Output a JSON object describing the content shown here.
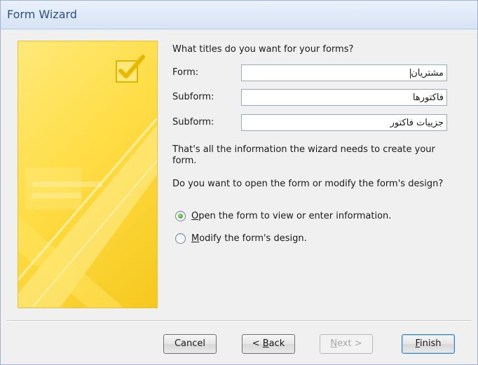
{
  "window": {
    "title": "Form Wizard"
  },
  "question": "What titles do you want for your forms?",
  "fields": [
    {
      "label": "Form:",
      "value": "مشتریان"
    },
    {
      "label": "Subform:",
      "value": "فاکتورها"
    },
    {
      "label": "Subform:",
      "value": "جزییات فاکتور"
    }
  ],
  "info_text": "That's all the information the wizard needs to create your form.",
  "prompt_text": "Do you want to open the form or modify the form's design?",
  "options": [
    {
      "mnemonic": "O",
      "rest": "pen the form to view or enter information.",
      "checked": true
    },
    {
      "mnemonic": "M",
      "rest": "odify the form's design.",
      "checked": false
    }
  ],
  "buttons": {
    "cancel": {
      "label": "Cancel"
    },
    "back": {
      "prefix": "< ",
      "mnemonic": "B",
      "rest": "ack"
    },
    "next": {
      "mnemonic": "N",
      "rest": "ext >",
      "disabled": true
    },
    "finish": {
      "mnemonic": "F",
      "rest": "inish"
    }
  },
  "colors": {
    "panel_yellow": "#ffdd45",
    "title_text": "#2c4f82",
    "check_green": "#2e8a17"
  },
  "icons": {
    "panel_check": "checkbox-checked-icon"
  }
}
